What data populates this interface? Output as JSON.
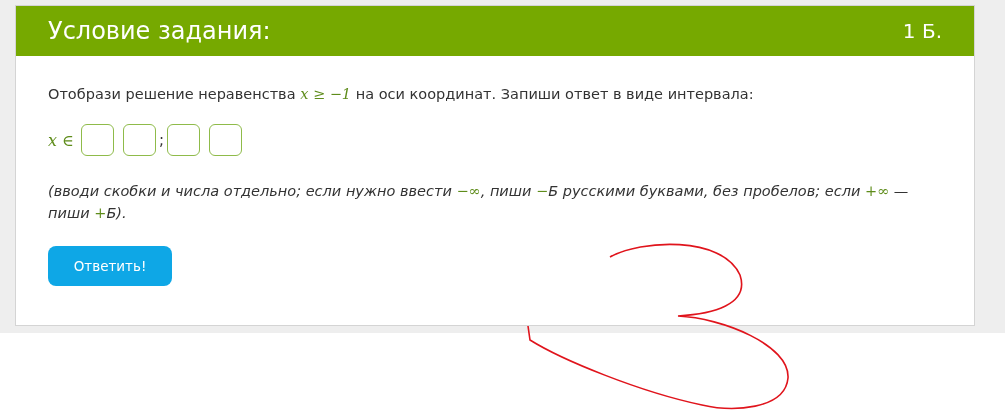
{
  "header": {
    "title": "Условие задания:",
    "points": "1 Б."
  },
  "question": [
    {
      "kind": "text",
      "text": "Отобрази решение неравенства "
    },
    {
      "kind": "math",
      "text": "x ≥ −1"
    },
    {
      "kind": "text",
      "text": " на оси координат. Запиши ответ в виде интервала:"
    }
  ],
  "answer": {
    "prefix": "x ∈",
    "items": [
      {
        "kind": "field"
      },
      {
        "kind": "field"
      },
      {
        "kind": "separator",
        "text": ";"
      },
      {
        "kind": "field"
      },
      {
        "kind": "field"
      }
    ]
  },
  "hint": [
    {
      "kind": "text",
      "text": "(вводи скобки и числа отдельно; если нужно ввести "
    },
    {
      "kind": "math",
      "text": "−∞"
    },
    {
      "kind": "text",
      "text": ", пиши  "
    },
    {
      "kind": "math",
      "text": "−"
    },
    {
      "kind": "text",
      "text": "Б русскими буквами, без пробелов; если "
    },
    {
      "kind": "math",
      "text": "+∞"
    },
    {
      "kind": "text",
      "text": " — пиши  "
    },
    {
      "kind": "math",
      "text": "+"
    },
    {
      "kind": "text",
      "text": "Б)."
    }
  ],
  "button": {
    "label": "Ответить!"
  }
}
